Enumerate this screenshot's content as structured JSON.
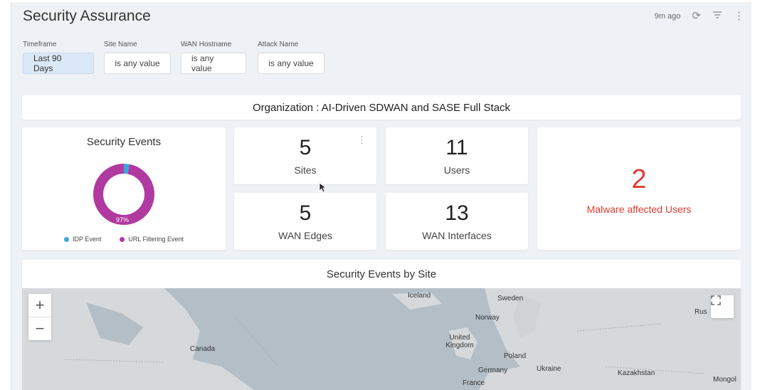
{
  "header": {
    "title": "Security Assurance",
    "updated": "9m ago"
  },
  "filters": [
    {
      "label": "Timeframe",
      "value": "Last 90 Days"
    },
    {
      "label": "Site Name",
      "value": "is any value"
    },
    {
      "label": "WAN Hostname",
      "value": "is any value"
    },
    {
      "label": "Attack Name",
      "value": "is any value"
    }
  ],
  "organization": {
    "text": "Organization : AI-Driven SDWAN and SASE Full Stack"
  },
  "security_events": {
    "title": "Security Events",
    "percent_label": "97%",
    "legend": [
      {
        "label": "IDP Event",
        "color": "#3aa6d8"
      },
      {
        "label": "URL Filtering Event",
        "color": "#b03aa0"
      }
    ],
    "chart_data": {
      "type": "pie",
      "labels": [
        "IDP Event",
        "URL Filtering Event"
      ],
      "values": [
        3,
        97
      ]
    }
  },
  "metrics": {
    "sites": {
      "value": "5",
      "label": "Sites"
    },
    "users": {
      "value": "11",
      "label": "Users"
    },
    "wan_edges": {
      "value": "5",
      "label": "WAN Edges"
    },
    "wan_interfaces": {
      "value": "13",
      "label": "WAN Interfaces"
    },
    "malware": {
      "value": "2",
      "label": "Malware affected Users"
    }
  },
  "map": {
    "title": "Security Events by Site",
    "zoom_in": "+",
    "zoom_out": "−",
    "places": {
      "iceland": "Iceland",
      "sweden": "Sweden",
      "norway": "Norway",
      "russia": "Rus",
      "united_kingdom": "United Kingdom",
      "canada": "Canada",
      "poland": "Poland",
      "germany": "Germany",
      "ukraine": "Ukraine",
      "kazakhstan": "Kazakhstan",
      "mongolia": "Mongol",
      "france": "France"
    }
  }
}
